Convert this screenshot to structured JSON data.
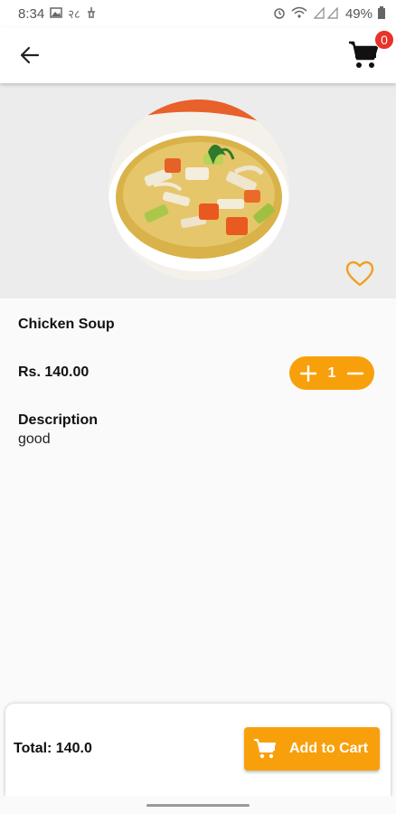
{
  "status_bar": {
    "time": "8:34",
    "carrier_text": "२८",
    "battery": "49%",
    "icons": [
      "gallery-icon",
      "notification-icon",
      "alarm-icon",
      "wifi-icon",
      "signal-icon",
      "battery-icon"
    ]
  },
  "app_bar": {
    "back_icon": "arrow-left-icon",
    "cart_icon": "shopping-cart-icon",
    "cart_count": "0"
  },
  "product": {
    "name": "Chicken Soup",
    "price": "Rs. 140.00",
    "quantity": "1",
    "description_heading": "Description",
    "description": "good",
    "favorite_icon": "heart-outline-icon"
  },
  "footer": {
    "total": "Total: 140.0",
    "add_to_cart_label": "Add to Cart",
    "add_to_cart_icon": "cart-plus-icon"
  },
  "colors": {
    "accent": "#f8a00c",
    "badge": "#e8332a",
    "hero_bg": "#ececec",
    "page_bg": "#fafafa"
  }
}
